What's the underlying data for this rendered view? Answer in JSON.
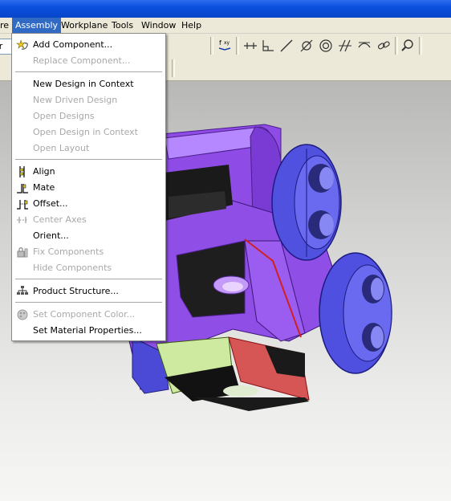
{
  "menubar": {
    "items": [
      {
        "label": "re"
      },
      {
        "label": "Assembly",
        "active": true
      },
      {
        "label": "Workplane"
      },
      {
        "label": "Tools"
      },
      {
        "label": "Window"
      },
      {
        "label": "Help"
      }
    ]
  },
  "toolbar": {
    "left_text": "er A",
    "icons": [
      "variable-icon",
      "point-icon",
      "perpendicular-icon",
      "line-icon",
      "angle-icon",
      "circle-icon",
      "parallel-icon",
      "tangent-icon",
      "chain-icon",
      "zoom-icon"
    ]
  },
  "assembly_menu": {
    "items": [
      {
        "label": "Add Component...",
        "enabled": true,
        "icon": "add-component-icon"
      },
      {
        "label": "Replace Component...",
        "enabled": false
      },
      {
        "label": "New Design in Context",
        "enabled": true
      },
      {
        "label": "New Driven Design",
        "enabled": false
      },
      {
        "label": "Open Designs",
        "enabled": false
      },
      {
        "label": "Open Design in Context",
        "enabled": false
      },
      {
        "label": "Open Layout",
        "enabled": false
      },
      {
        "label": "Align",
        "enabled": true,
        "icon": "align-icon"
      },
      {
        "label": "Mate",
        "enabled": true,
        "icon": "mate-icon"
      },
      {
        "label": "Offset...",
        "enabled": true,
        "icon": "offset-icon"
      },
      {
        "label": "Center Axes",
        "enabled": false,
        "icon": "center-axes-icon"
      },
      {
        "label": "Orient...",
        "enabled": true
      },
      {
        "label": "Fix Components",
        "enabled": false,
        "icon": "fix-components-icon"
      },
      {
        "label": "Hide Components",
        "enabled": false
      },
      {
        "label": "Product Structure...",
        "enabled": true,
        "icon": "product-structure-icon"
      },
      {
        "label": "Set Component Color...",
        "enabled": false,
        "icon": "color-icon"
      },
      {
        "label": "Set Material Properties...",
        "enabled": true
      }
    ]
  },
  "colors": {
    "menu_highlight": "#316ac5",
    "part_purple": "#9a55f0",
    "part_blue": "#5c5ce6",
    "face_green": "#d6f0a0",
    "face_red": "#d85050"
  }
}
